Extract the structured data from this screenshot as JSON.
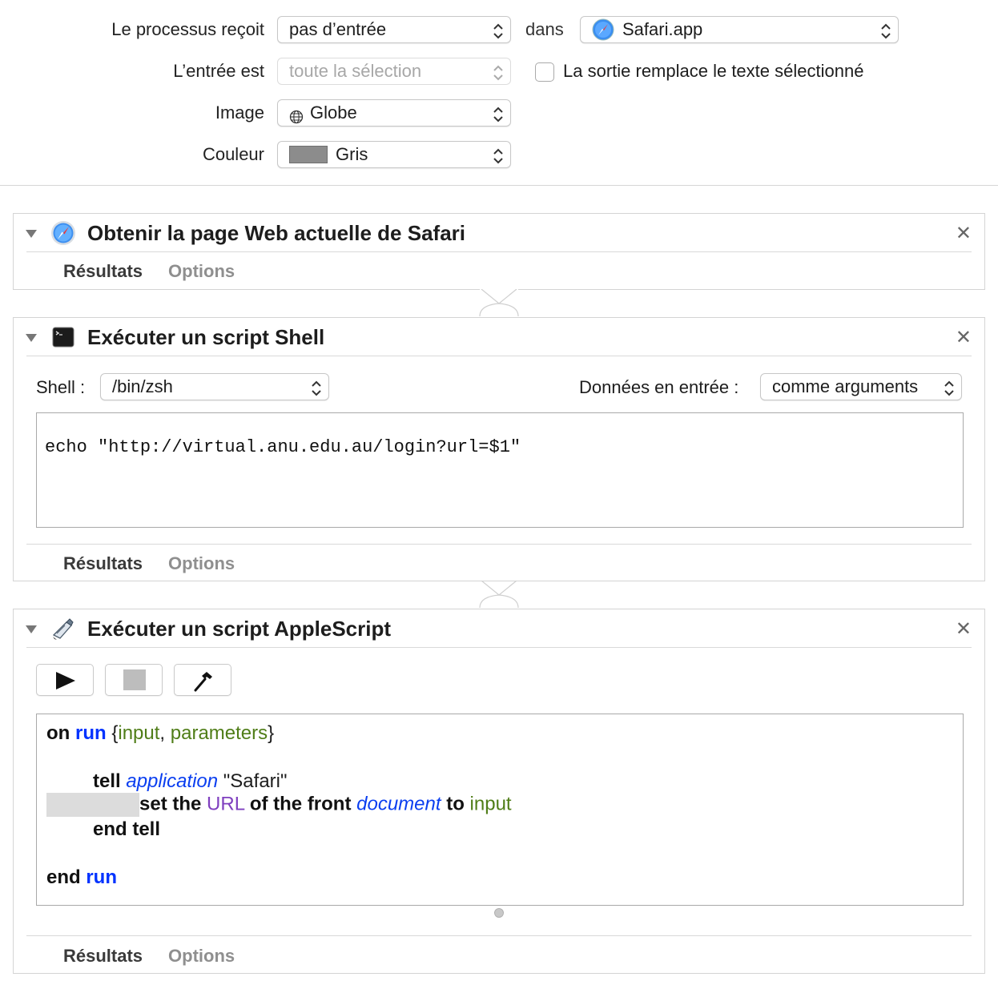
{
  "settings": {
    "receives_label": "Le processus reçoit",
    "receives_value": "pas d’entrée",
    "in_label": "dans",
    "app_value": "Safari.app",
    "input_is_label": "L’entrée est",
    "input_is_value": "toute la sélection",
    "replace_checkbox_label": "La sortie remplace le texte sélectionné",
    "replace_checked": false,
    "image_label": "Image",
    "image_value": "Globe",
    "color_label": "Couleur",
    "color_value": "Gris",
    "color_swatch": "#8c8c8c"
  },
  "actions": [
    {
      "title": "Obtenir la page Web actuelle de Safari",
      "icon": "safari-icon",
      "results_tab": "Résultats",
      "options_tab": "Options"
    },
    {
      "title": "Exécuter un script Shell",
      "icon": "terminal-icon",
      "shell_label": "Shell :",
      "shell_value": "/bin/zsh",
      "input_data_label": "Données en entrée :",
      "input_data_value": "comme arguments",
      "script": "echo \"http://virtual.anu.edu.au/login?url=$1\"",
      "results_tab": "Résultats",
      "options_tab": "Options"
    },
    {
      "title": "Exécuter un script AppleScript",
      "icon": "script-editor-icon",
      "results_tab": "Résultats",
      "options_tab": "Options",
      "code": {
        "l1_on": "on",
        "l1_run": "run",
        "l1_open": "{",
        "l1_input": "input",
        "l1_comma": ", ",
        "l1_parameters": "parameters",
        "l1_close": "}",
        "l2_tell": "tell",
        "l2_application": "application",
        "l2_safari": "\"Safari\"",
        "l3_set": "set the",
        "l3_url": "URL",
        "l3_of": "of the front",
        "l3_document": "document",
        "l3_to": "to",
        "l3_input": "input",
        "l4_end_tell": "end tell",
        "l5_end": "end",
        "l5_run": "run"
      }
    }
  ],
  "colors": {
    "keyword_blue": "#0032ff",
    "variable_green": "#4f7d17",
    "property_purple": "#7f3fbf"
  }
}
